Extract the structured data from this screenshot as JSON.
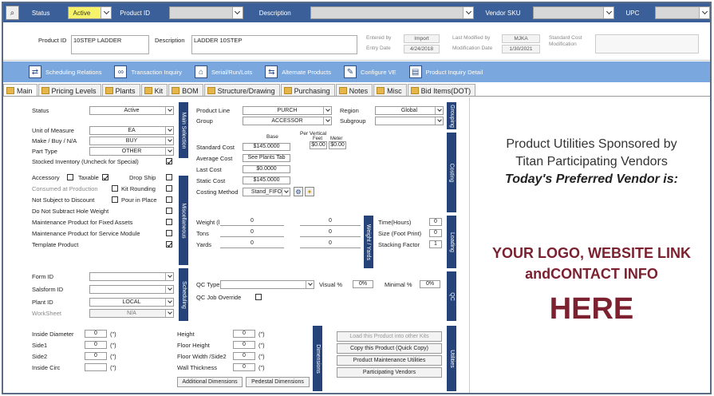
{
  "filter": {
    "status_label": "Status",
    "status_value": "Active",
    "product_id_label": "Product ID",
    "description_label": "Description",
    "vendor_sku_label": "Vendor SKU",
    "upc_label": "UPC"
  },
  "header": {
    "product_id_label": "Product ID",
    "product_id_value": "10STEP LADDER",
    "description_label": "Description",
    "description_value": "LADDER 10STEP",
    "entered_by_label": "Entered by",
    "entered_by_value": "Import",
    "entry_date_label": "Entry Date",
    "entry_date_value": "4/24/2018",
    "last_modified_label": "Last Modified by",
    "last_modified_value": "MJKA",
    "mod_date_label": "Modification Date",
    "mod_date_value": "1/30/2021",
    "std_cost_mod_label": "Standard Cost Modification"
  },
  "toolbar": [
    "Scheduling Relations",
    "Transaction Inquiry",
    "Serial/Run/Lots",
    "Alternate Products",
    "Configure VE",
    "Product Inquiry Detail"
  ],
  "tabs": [
    "Main",
    "Pricing Levels",
    "Plants",
    "Kit",
    "BOM",
    "Structure/Drawing",
    "Purchasing",
    "Notes",
    "Misc",
    "Bid Items(DOT)"
  ],
  "main": {
    "status_label": "Status",
    "status_value": "Active",
    "uom_label": "Unit of Measure",
    "uom_value": "EA",
    "make_buy_label": "Make / Buy / N/A",
    "make_buy_value": "BUY",
    "part_type_label": "Part Type",
    "part_type_value": "OTHER",
    "stocked_label": "Stocked Inventory (Uncheck for Special)",
    "accessory_label": "Accessory",
    "taxable_label": "Taxable",
    "drop_ship_label": "Drop Ship",
    "consumed_label": "Consumed at Production",
    "kit_rounding_label": "Kit Rounding",
    "not_discount_label": "Not Subject to Discount",
    "pour_label": "Pour in Place",
    "hole_weight_label": "Do Not Subtract Hole Weight",
    "fixed_assets_label": "Maintenance Product for Fixed Assets",
    "service_module_label": "Maintenance Product for Service Module",
    "template_label": "Template Product",
    "form_id_label": "Form ID",
    "salsform_label": "Salsform ID",
    "plant_id_label": "Plant ID",
    "plant_id_value": "LOCAL",
    "worksheet_label": "WorkSheet",
    "worksheet_value": "N/A",
    "side_main": "Main Selection",
    "side_misc": "Miscellaneous",
    "side_sched": "Scheduling"
  },
  "pricing": {
    "product_line_label": "Product Line",
    "product_line_value": "PURCH",
    "group_label": "Group",
    "group_value": "ACCESSOR",
    "region_label": "Region",
    "region_value": "Global",
    "subgroup_label": "Subgroup",
    "base_label": "Base",
    "per_vertical_label": "Per Vertical",
    "feet_label": "Feet",
    "meter_label": "Meter",
    "std_cost_label": "Standard Cost",
    "std_cost_value": "$145.0000",
    "feet_value": "$0.00",
    "meter_value": "$0.00",
    "avg_cost_label": "Average Cost",
    "avg_cost_value": "See Plants Tab",
    "last_cost_label": "Last Cost",
    "last_cost_value": "$0.0000",
    "static_cost_label": "Static Cost",
    "static_cost_value": "$145.0000",
    "costing_label": "Costing Method",
    "costing_value": "Stand_FIFO",
    "side_grouping": "Grouping",
    "side_costing": "Costing"
  },
  "weights": {
    "weight_label": "Weight (lb)",
    "weight_value": "0",
    "weight_value2": "0",
    "tons_label": "Tons",
    "tons_value": "0",
    "tons_value2": "0",
    "yards_label": "Yards",
    "yards_value": "0",
    "yards_value2": "0",
    "side_wv": "Weight / Yards",
    "time_label": "Time(Hours)",
    "time_value": "0",
    "size_label": "Size (Foot Print)",
    "size_value": "0",
    "stacking_label": "Stacking Factor",
    "stacking_value": "1",
    "side_loading": "Loading"
  },
  "qc": {
    "qc_type_label": "QC Type",
    "visual_label": "Visual %",
    "visual_value": "0%",
    "minimal_label": "Minimal %",
    "minimal_value": "0%",
    "override_label": "QC Job Override",
    "side_qc": "QC"
  },
  "dims": {
    "inside_diam_label": "Inside Diameter",
    "inside_diam_value": "0",
    "unit": "(\")",
    "side1_label": "Side1",
    "side1_value": "0",
    "side2_label": "Side2",
    "side2_value": "0",
    "inside_circ_label": "Inside Circ",
    "height_label": "Height",
    "height_value": "0",
    "floor_height_label": "Floor Height",
    "floor_height_value": "0",
    "floor_width_label": "Floor Width /Side2",
    "floor_width_value": "0",
    "wall_label": "Wall Thickness",
    "wall_value": "0",
    "additional_btn": "Additional Dimensions",
    "pedestal_btn": "Pedestal Dimensions",
    "side_dims": "Dimensions"
  },
  "utilities": {
    "load_btn": "Load this Product into other Kits",
    "copy_btn": "Copy this Product (Quick Copy)",
    "maint_btn": "Product Maintenance Utilities",
    "vendors_btn": "Participating Vendors",
    "side_util": "Utilities"
  },
  "ad": {
    "line1": "Product Utilities Sponsored by",
    "line2": "Titan Participating Vendors",
    "line3": "Today's Preferred Vendor is:",
    "line4": "YOUR LOGO, WEBSITE LINK",
    "line5": "andCONTACT INFO",
    "line6": "HERE",
    "title_color": "#7b2130"
  }
}
